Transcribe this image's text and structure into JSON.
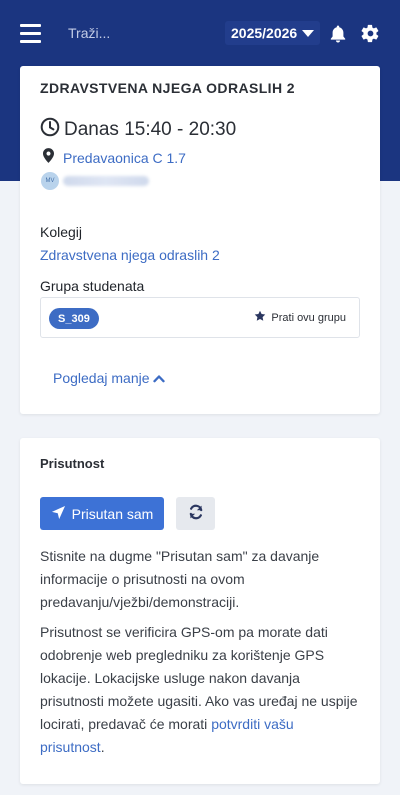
{
  "colors": {
    "hero_bg": "#1b3580",
    "accent": "#3d6cc4",
    "primary_button": "#3d72d6",
    "page_bg": "#f0f3f8"
  },
  "topbar": {
    "menu_icon": "hamburger-icon",
    "search_placeholder": "Traži...",
    "year": "2025/2026",
    "notification_icon": "bell-icon",
    "settings_icon": "gear-icon"
  },
  "session": {
    "course_title": "ZDRAVSTVENA NJEGA ODRASLIH 2",
    "time": "Danas 15:40 - 20:30",
    "room": "Predavaonica C 1.7",
    "lecturer_initials": "MV",
    "course_label": "Kolegij",
    "course_name": "Zdravstvena njega odraslih 2",
    "group_label": "Grupa studenata",
    "group_code": "S_309",
    "follow_label": "Prati ovu grupu",
    "show_less": "Pogledaj manje"
  },
  "attendance": {
    "title": "Prisutnost",
    "present_button": "Prisutan sam",
    "para1": "Stisnite na dugme \"Prisutan sam\" za davanje informacije o prisutnosti na ovom predavanju/vježbi/demonstraciji.",
    "para2_text": "Prisutnost se verificira GPS-om pa morate dati odobrenje web pregledniku za korištenje GPS lokacije. Lokacijske usluge nakon davanja prisutnosti možete ugasiti. Ako vas uređaj ne uspije locirati, predavač će morati ",
    "para2_link": "potvrditi vašu prisutnost",
    "para2_end": "."
  }
}
